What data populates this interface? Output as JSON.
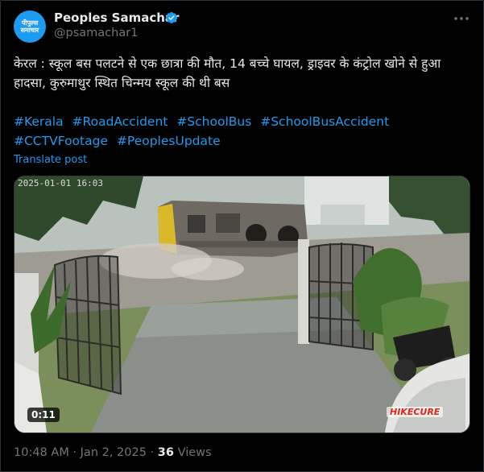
{
  "author": {
    "avatar_lines": [
      "पीपुल्स",
      "समाचार"
    ],
    "name": "Peoples Samachar",
    "handle": "@psamachar1",
    "verified_icon": "verified-badge-icon",
    "more_icon": "more-icon"
  },
  "post": {
    "text": "केरल : स्कूल बस पलटने से एक छात्रा की मौत, 14 बच्चे घायल, ड्राइवर के कंट्रोल खोने से हुआ हादसा, कुरुमाथुर स्थित चिन्मय स्कूल की थी बस",
    "hashtags": [
      "#Kerala",
      "#RoadAccident",
      "#SchoolBus",
      "#SchoolBusAccident",
      "#CCTVFootage",
      "#PeoplesUpdate"
    ],
    "translate_label": "Translate post"
  },
  "video": {
    "cctv_timestamp": "2025-01-01 16:03",
    "duration": "0:11",
    "watermark": "HIKECURE"
  },
  "meta": {
    "time": "10:48 AM",
    "separator": " · ",
    "date": "Jan 2, 2025",
    "views_count": "36",
    "views_label": "Views"
  },
  "colors": {
    "accent": "#1d9bf0",
    "background": "#000000",
    "text_primary": "#e7e9ea",
    "text_secondary": "#71767b"
  }
}
